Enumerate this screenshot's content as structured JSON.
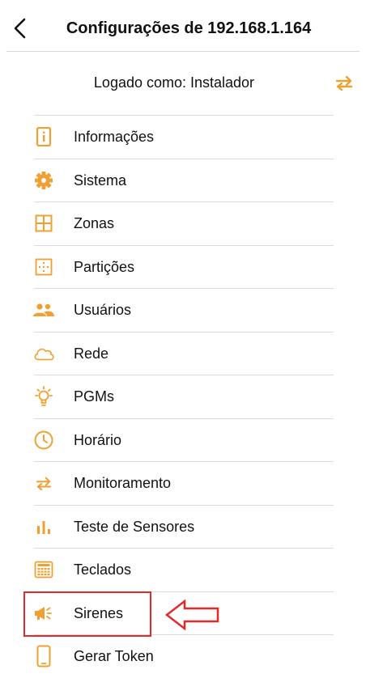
{
  "header": {
    "title": "Configurações de 192.168.1.164"
  },
  "logged": {
    "text": "Logado como: Instalador"
  },
  "menu": [
    {
      "label": "Informações",
      "icon": "info-icon"
    },
    {
      "label": "Sistema",
      "icon": "gear-icon"
    },
    {
      "label": "Zonas",
      "icon": "grid-icon"
    },
    {
      "label": "Partições",
      "icon": "partition-icon"
    },
    {
      "label": "Usuários",
      "icon": "users-icon"
    },
    {
      "label": "Rede",
      "icon": "cloud-icon"
    },
    {
      "label": "PGMs",
      "icon": "lightbulb-icon"
    },
    {
      "label": "Horário",
      "icon": "clock-icon"
    },
    {
      "label": "Monitoramento",
      "icon": "swap-arrows-icon"
    },
    {
      "label": "Teste de Sensores",
      "icon": "bars-icon"
    },
    {
      "label": "Teclados",
      "icon": "keypad-icon"
    },
    {
      "label": "Sirenes",
      "icon": "megaphone-icon"
    },
    {
      "label": "Gerar Token",
      "icon": "phone-icon"
    }
  ],
  "colors": {
    "accent": "#f0a030",
    "highlight": "#e22a2a",
    "divider": "#dcdcdc"
  }
}
